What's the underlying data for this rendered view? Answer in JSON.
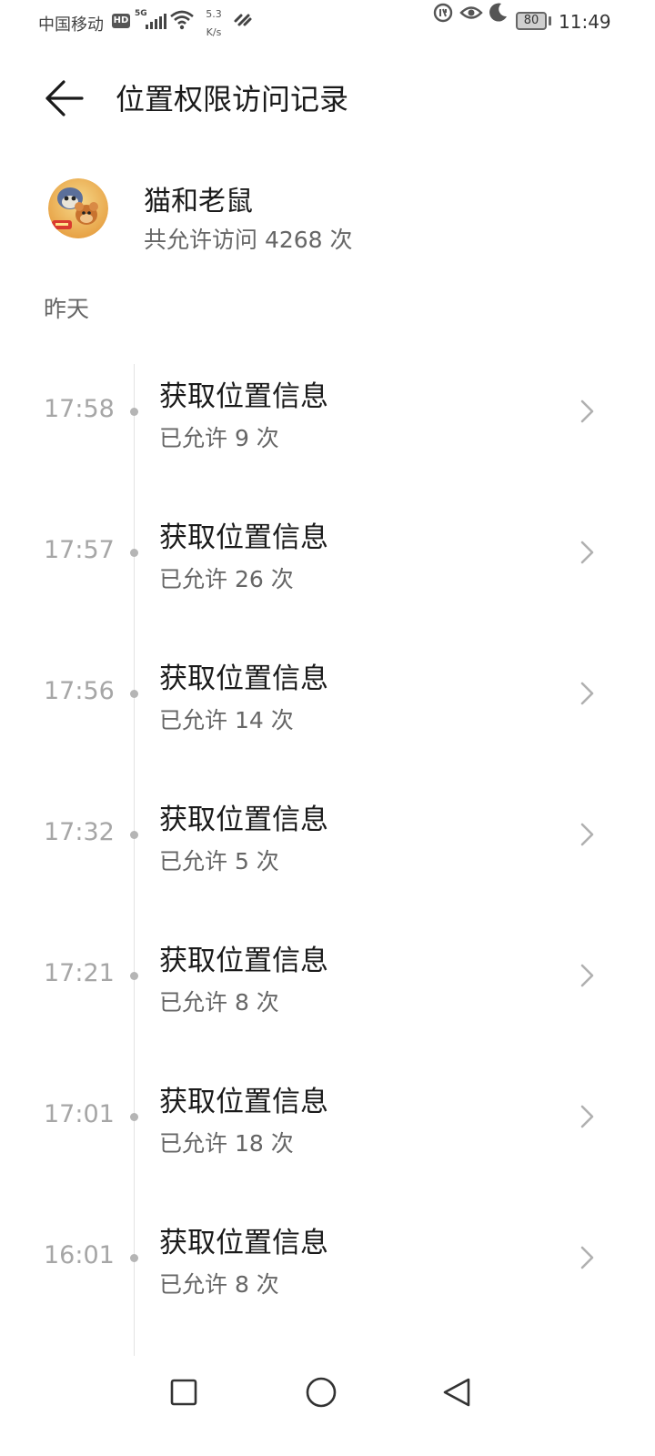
{
  "status_bar": {
    "carrier": "中国移动",
    "hd_badge": "HD",
    "network": "5G",
    "speed_value": "5.3",
    "speed_unit": "K/s",
    "battery": "80",
    "time": "11:49"
  },
  "header": {
    "title": "位置权限访问记录"
  },
  "app": {
    "name": "猫和老鼠",
    "count_text": "共允许访问 4268 次"
  },
  "day_label": "昨天",
  "entries": [
    {
      "time": "17:58",
      "title": "获取位置信息",
      "subtitle": "已允许 9 次"
    },
    {
      "time": "17:57",
      "title": "获取位置信息",
      "subtitle": "已允许 26 次"
    },
    {
      "time": "17:56",
      "title": "获取位置信息",
      "subtitle": "已允许 14 次"
    },
    {
      "time": "17:32",
      "title": "获取位置信息",
      "subtitle": "已允许 5 次"
    },
    {
      "time": "17:21",
      "title": "获取位置信息",
      "subtitle": "已允许 8 次"
    },
    {
      "time": "17:01",
      "title": "获取位置信息",
      "subtitle": "已允许 18 次"
    },
    {
      "time": "16:01",
      "title": "获取位置信息",
      "subtitle": "已允许 8 次"
    }
  ],
  "colors": {
    "background": "#ffffff",
    "primary_text": "#1a1a1a",
    "secondary_text": "#666666",
    "time_text": "#a6a6a6"
  },
  "icons": {
    "back": "arrow-left-icon",
    "chevron": "chevron-right-icon",
    "nav_recent": "square-icon",
    "nav_home": "circle-icon",
    "nav_back": "triangle-left-icon"
  }
}
